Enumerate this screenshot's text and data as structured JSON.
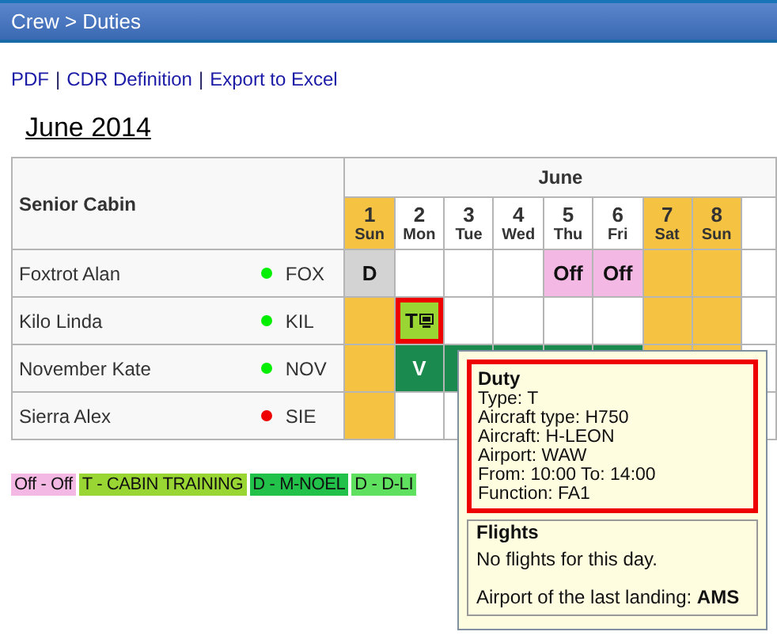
{
  "header": {
    "title": "Crew > Duties"
  },
  "links": [
    {
      "kind": "link",
      "text": "PDF"
    },
    {
      "kind": "separator",
      "text": "|"
    },
    {
      "kind": "link",
      "text": "CDR Definition"
    },
    {
      "kind": "separator",
      "text": "|"
    },
    {
      "kind": "link",
      "text": "Export to Excel"
    }
  ],
  "month_title": "June 2014",
  "table": {
    "group_heading": "Senior Cabin",
    "month": "June",
    "days": [
      {
        "number": "1",
        "weekday": "Sun",
        "weekend": true
      },
      {
        "number": "2",
        "weekday": "Mon",
        "weekend": false
      },
      {
        "number": "3",
        "weekday": "Tue",
        "weekend": false
      },
      {
        "number": "4",
        "weekday": "Wed",
        "weekend": false
      },
      {
        "number": "5",
        "weekday": "Thu",
        "weekend": false
      },
      {
        "number": "6",
        "weekday": "Fri",
        "weekend": false
      },
      {
        "number": "7",
        "weekday": "Sat",
        "weekend": true
      },
      {
        "number": "8",
        "weekday": "Sun",
        "weekend": true
      }
    ],
    "rows": [
      {
        "name": "Foxtrot Alan",
        "color": "#00ee00",
        "code": "FOX",
        "cells": [
          {
            "text": "D",
            "color": "#d3d3d3",
            "selected": false
          },
          {
            "color": "#ffffff",
            "selected": false
          },
          {
            "color": "#ffffff",
            "selected": false
          },
          {
            "color": "#ffffff",
            "selected": false
          },
          {
            "text": "Off",
            "color": "#f4b8e4",
            "selected": false
          },
          {
            "text": "Off",
            "color": "#f4b8e4",
            "selected": false
          },
          {
            "color": "#f5c242",
            "selected": false
          },
          {
            "color": "#f5c242",
            "selected": false
          }
        ]
      },
      {
        "name": "Kilo Linda",
        "color": "#00ee00",
        "code": "KIL",
        "cells": [
          {
            "color": "#f5c242",
            "selected": false
          },
          {
            "text": "T",
            "icon": true,
            "color": "#9ad633",
            "selected": true
          },
          {
            "color": "#ffffff",
            "selected": false
          },
          {
            "color": "#ffffff",
            "selected": false
          },
          {
            "color": "#ffffff",
            "selected": false
          },
          {
            "color": "#ffffff",
            "selected": false
          },
          {
            "color": "#f5c242",
            "selected": false
          },
          {
            "color": "#f5c242",
            "selected": false
          }
        ]
      },
      {
        "name": "November Kate",
        "color": "#00ee00",
        "code": "NOV",
        "cells": [
          {
            "color": "#f5c242",
            "selected": false
          },
          {
            "text": "V",
            "color": "#1b8a4f",
            "selected": false
          },
          {
            "color": "#1b8a4f",
            "selected": false
          },
          {
            "color": "#1b8a4f",
            "selected": false
          },
          {
            "color": "#1b8a4f",
            "selected": false
          },
          {
            "color": "#1b8a4f",
            "selected": false
          },
          {
            "color": "#f5c242",
            "selected": false
          },
          {
            "color": "#f5c242",
            "selected": false
          }
        ]
      },
      {
        "name": "Sierra Alex",
        "color": "#ee0000",
        "code": "SIE",
        "cells": [
          {
            "color": "#f5c242",
            "selected": false
          },
          {
            "color": "#ffffff",
            "selected": false
          },
          {
            "color": "#ffffff",
            "selected": false
          }
        ]
      }
    ]
  },
  "legend": [
    {
      "label": "Off - Off",
      "color": "#f4b8e4"
    },
    {
      "label": "T - CABIN TRAINING",
      "color": "#9ad633"
    },
    {
      "label": "D - M-NOEL",
      "color": "#22c24a"
    },
    {
      "label": "D - D-LI",
      "color": "#5fe05f"
    }
  ],
  "tooltip": {
    "duty": {
      "title": "Duty",
      "lines": [
        "Type: T",
        "Aircraft type: H750",
        "Aircraft: H-LEON",
        "Airport: WAW",
        "From: 10:00 To: 14:00",
        "Function: FA1"
      ]
    },
    "flights": {
      "title": "Flights",
      "message": "No flights for this day.",
      "last_landing": "Airport of the last landing: **AMS**"
    }
  }
}
